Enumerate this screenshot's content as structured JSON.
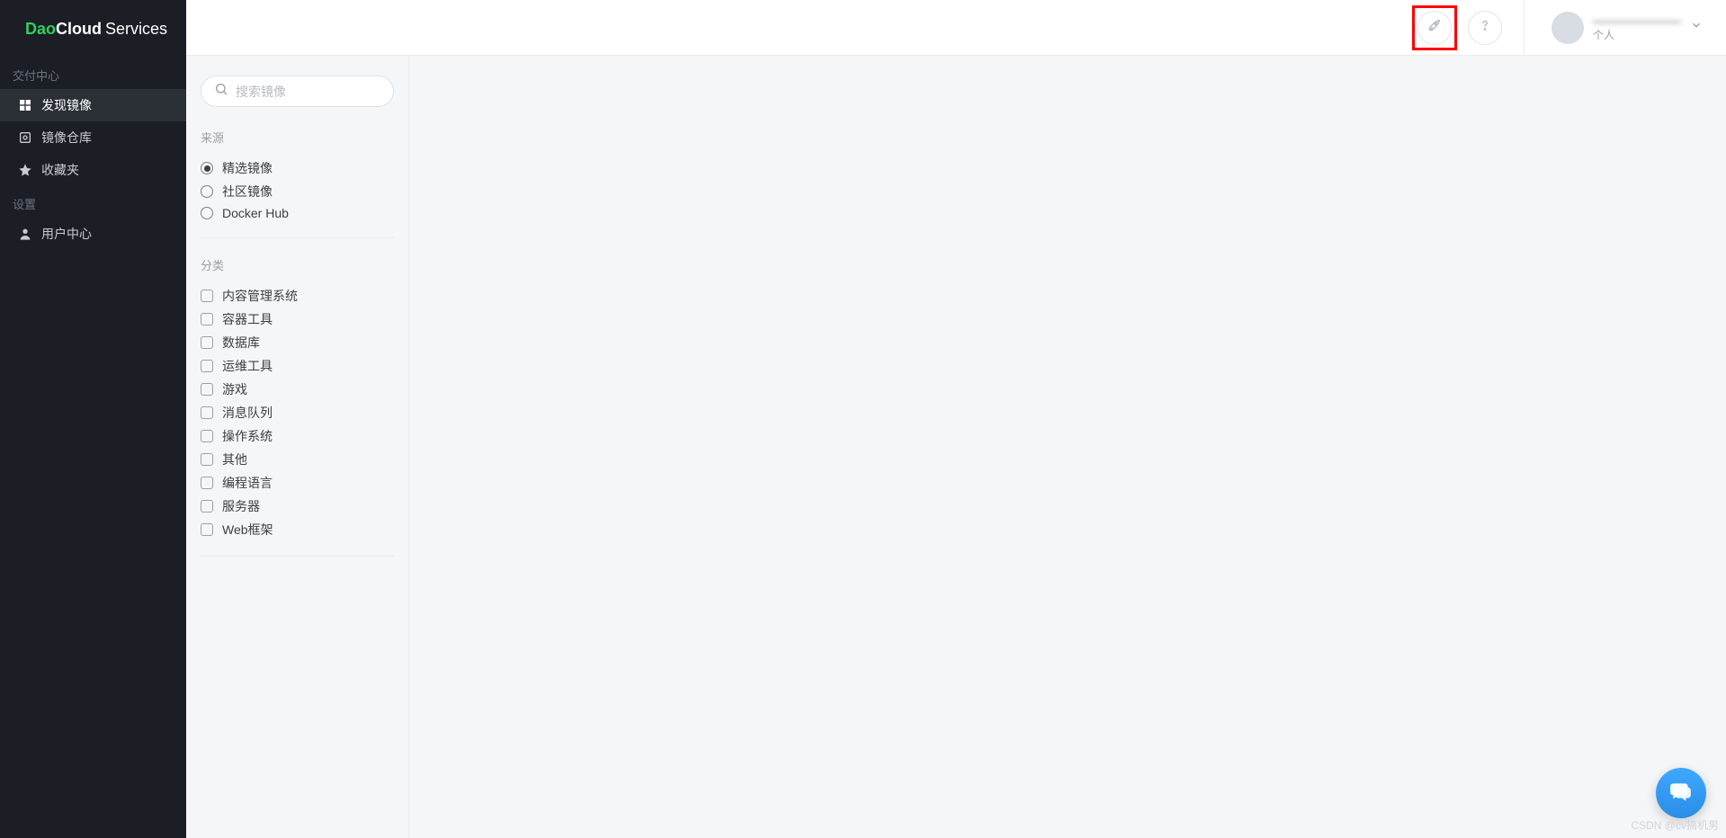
{
  "logo": {
    "dao": "Dao",
    "cloud": "Cloud",
    "services": "Services"
  },
  "sidebar": {
    "sections": [
      {
        "header": "交付中心",
        "items": [
          {
            "label": "发现镜像",
            "icon": "grid-icon",
            "active": true
          },
          {
            "label": "镜像仓库",
            "icon": "disk-icon",
            "active": false
          },
          {
            "label": "收藏夹",
            "icon": "star-icon",
            "active": false
          }
        ]
      },
      {
        "header": "设置",
        "items": [
          {
            "label": "用户中心",
            "icon": "user-icon",
            "active": false
          }
        ]
      }
    ]
  },
  "header": {
    "rocket_tooltip": "rocket",
    "help_tooltip": "help",
    "user": {
      "name": "———————",
      "type": "个人"
    }
  },
  "filters": {
    "search_placeholder": "搜索镜像",
    "source": {
      "title": "来源",
      "options": [
        {
          "label": "精选镜像",
          "checked": true
        },
        {
          "label": "社区镜像",
          "checked": false
        },
        {
          "label": "Docker Hub",
          "checked": false
        }
      ]
    },
    "category": {
      "title": "分类",
      "options": [
        {
          "label": "内容管理系统",
          "checked": false
        },
        {
          "label": "容器工具",
          "checked": false
        },
        {
          "label": "数据库",
          "checked": false
        },
        {
          "label": "运维工具",
          "checked": false
        },
        {
          "label": "游戏",
          "checked": false
        },
        {
          "label": "消息队列",
          "checked": false
        },
        {
          "label": "操作系统",
          "checked": false
        },
        {
          "label": "其他",
          "checked": false
        },
        {
          "label": "编程语言",
          "checked": false
        },
        {
          "label": "服务器",
          "checked": false
        },
        {
          "label": "Web框架",
          "checked": false
        }
      ]
    }
  },
  "watermark": "CSDN @cv搞机男"
}
